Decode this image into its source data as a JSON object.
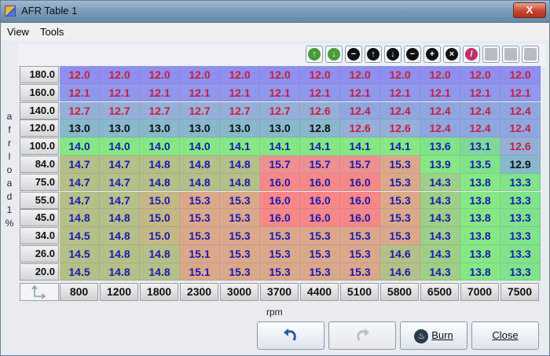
{
  "window": {
    "title": "AFR Table 1",
    "close_label": "X"
  },
  "menu": {
    "view": "View",
    "tools": "Tools"
  },
  "toolbar": {
    "buttons": [
      {
        "icon": "green-arrow-up-icon",
        "glyph": "↑",
        "color": "#4a9a3a"
      },
      {
        "icon": "green-arrow-down-icon",
        "glyph": "↓",
        "color": "#4a9a3a"
      },
      {
        "icon": "minus-icon",
        "glyph": "−",
        "color": "#111"
      },
      {
        "icon": "arrow-up-icon",
        "glyph": "↑",
        "color": "#111"
      },
      {
        "icon": "arrow-down-icon",
        "glyph": "↓",
        "color": "#111"
      },
      {
        "icon": "minus-circle-icon",
        "glyph": "−",
        "color": "#111"
      },
      {
        "icon": "plus-icon",
        "glyph": "+",
        "color": "#111"
      },
      {
        "icon": "times-icon",
        "glyph": "×",
        "color": "#111"
      },
      {
        "icon": "pencil-icon",
        "glyph": "/",
        "color": "#c03070"
      },
      {
        "icon": "rows-icon",
        "glyph": "",
        "color": "#b8bcc2"
      },
      {
        "icon": "columns-icon",
        "glyph": "",
        "color": "#b8bcc2"
      },
      {
        "icon": "grid-icon",
        "glyph": "",
        "color": "#b8bcc2"
      }
    ]
  },
  "y_axis": {
    "label": "afrload1%",
    "values": [
      "180.0",
      "160.0",
      "140.0",
      "120.0",
      "100.0",
      "84.0",
      "75.0",
      "55.0",
      "45.0",
      "34.0",
      "26.0",
      "20.0"
    ]
  },
  "x_axis": {
    "label": "rpm",
    "values": [
      "800",
      "1200",
      "1800",
      "2300",
      "3000",
      "3700",
      "4400",
      "5100",
      "5800",
      "6500",
      "7000",
      "7500"
    ]
  },
  "table": [
    [
      "12.0",
      "12.0",
      "12.0",
      "12.0",
      "12.0",
      "12.0",
      "12.0",
      "12.0",
      "12.0",
      "12.0",
      "12.0",
      "12.0"
    ],
    [
      "12.1",
      "12.1",
      "12.1",
      "12.1",
      "12.1",
      "12.1",
      "12.1",
      "12.1",
      "12.1",
      "12.1",
      "12.1",
      "12.1"
    ],
    [
      "12.7",
      "12.7",
      "12.7",
      "12.7",
      "12.7",
      "12.7",
      "12.6",
      "12.4",
      "12.4",
      "12.4",
      "12.4",
      "12.4"
    ],
    [
      "13.0",
      "13.0",
      "13.0",
      "13.0",
      "13.0",
      "13.0",
      "12.8",
      "12.6",
      "12.6",
      "12.4",
      "12.4",
      "12.4"
    ],
    [
      "14.0",
      "14.0",
      "14.0",
      "14.0",
      "14.1",
      "14.1",
      "14.1",
      "14.1",
      "14.1",
      "13.6",
      "13.1",
      "12.6"
    ],
    [
      "14.7",
      "14.7",
      "14.8",
      "14.8",
      "14.8",
      "15.7",
      "15.7",
      "15.7",
      "15.3",
      "13.9",
      "13.5",
      "12.9"
    ],
    [
      "14.7",
      "14.7",
      "14.8",
      "14.8",
      "14.8",
      "16.0",
      "16.0",
      "16.0",
      "15.3",
      "14.3",
      "13.8",
      "13.3"
    ],
    [
      "14.7",
      "14.7",
      "15.0",
      "15.3",
      "15.3",
      "16.0",
      "16.0",
      "16.0",
      "15.3",
      "14.3",
      "13.8",
      "13.3"
    ],
    [
      "14.8",
      "14.8",
      "15.0",
      "15.3",
      "15.3",
      "16.0",
      "16.0",
      "16.0",
      "15.3",
      "14.3",
      "13.8",
      "13.3"
    ],
    [
      "14.5",
      "14.8",
      "15.0",
      "15.3",
      "15.3",
      "15.3",
      "15.3",
      "15.3",
      "15.3",
      "14.3",
      "13.8",
      "13.3"
    ],
    [
      "14.5",
      "14.8",
      "14.8",
      "15.1",
      "15.3",
      "15.3",
      "15.3",
      "15.3",
      "14.6",
      "14.3",
      "13.8",
      "13.3"
    ],
    [
      "14.5",
      "14.8",
      "14.8",
      "15.1",
      "15.3",
      "15.3",
      "15.3",
      "15.3",
      "14.6",
      "14.3",
      "13.8",
      "13.3"
    ]
  ],
  "buttons": {
    "undo_icon": "undo-icon",
    "redo_icon": "redo-icon",
    "burn": "Burn",
    "close": "Close"
  }
}
